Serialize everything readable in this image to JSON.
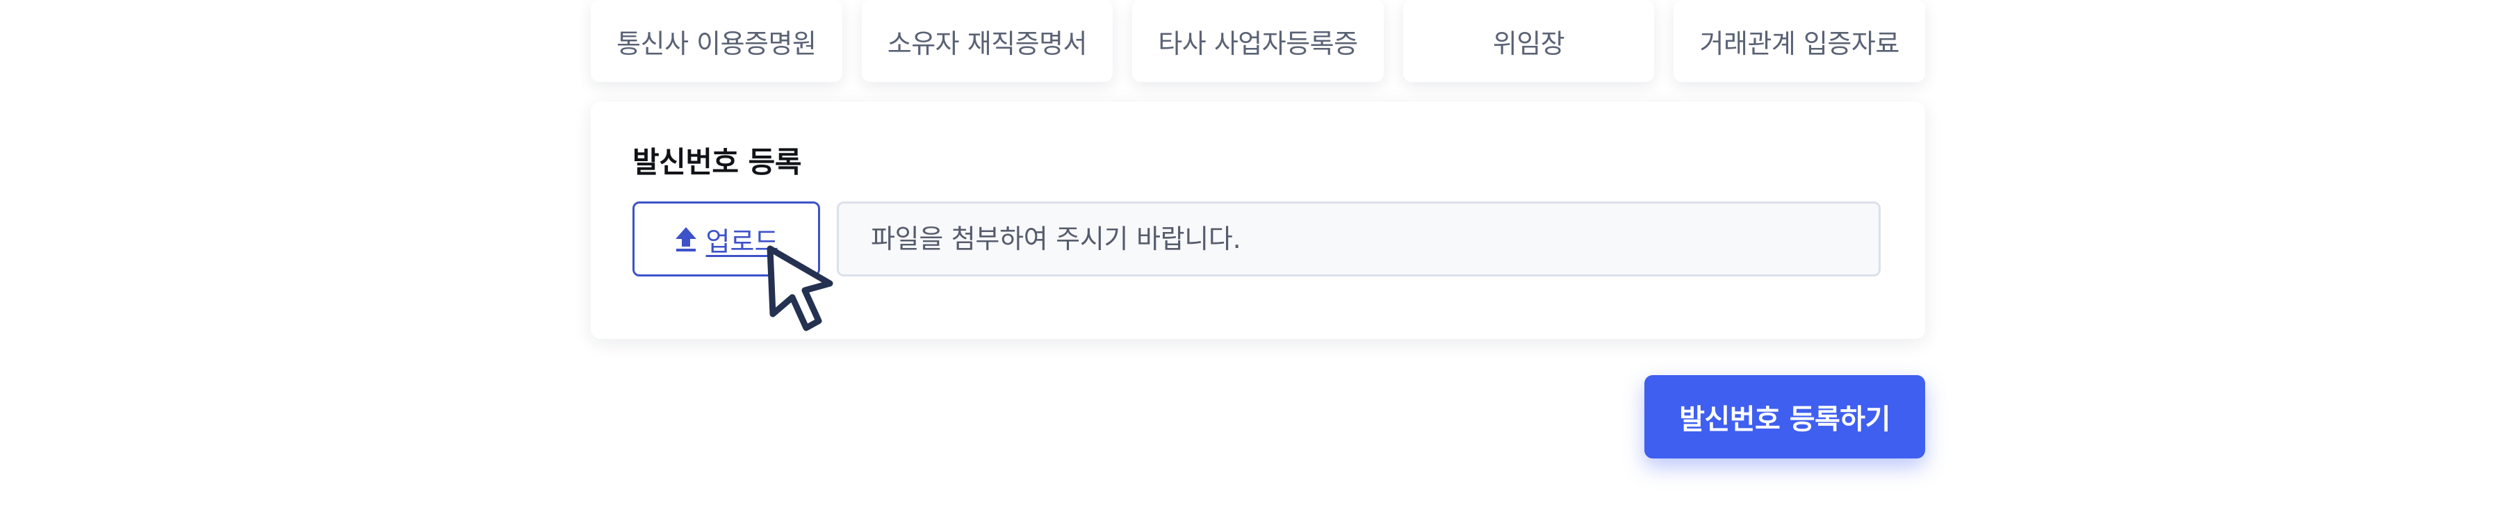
{
  "tabs": [
    {
      "label": "통신사 이용증명원"
    },
    {
      "label": "소유자 재직증명서"
    },
    {
      "label": "타사 사업자등록증"
    },
    {
      "label": "위임장"
    },
    {
      "label": "거래관계 입증자료"
    }
  ],
  "card": {
    "title": "발신번호 등록",
    "upload_label": "업로드",
    "upload_icon": "upload-arrow-icon",
    "file_placeholder": "파일을 첨부하여 주시기 바랍니다."
  },
  "submit_label": "발신번호 등록하기",
  "colors": {
    "accent": "#3f5ff0",
    "upload_border": "#3d52c9",
    "tab_text": "#5a6275",
    "field_bg": "#f8f9fb"
  }
}
